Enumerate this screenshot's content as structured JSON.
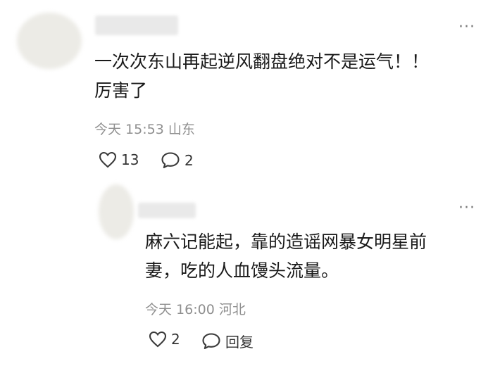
{
  "comments": [
    {
      "text_line1": "一次次东山再起逆风翻盘绝对不是运气！！",
      "text_line2": "厉害了",
      "time": "今天 15:53 山东",
      "likes": "13",
      "replies": "2"
    }
  ],
  "reply": {
    "text_line1": "麻六记能起，靠的造谣网暴女明星前",
    "text_line2": "妻，吃的人血馒头流量。",
    "time": "今天 16:00 河北",
    "likes": "2",
    "reply_label": "回复"
  },
  "icons": {
    "more": "more-dots-icon",
    "like": "heart-icon",
    "comment": "comment-bubble-icon"
  },
  "colors": {
    "text": "#1a1a1a",
    "meta": "#8f8f8f"
  }
}
